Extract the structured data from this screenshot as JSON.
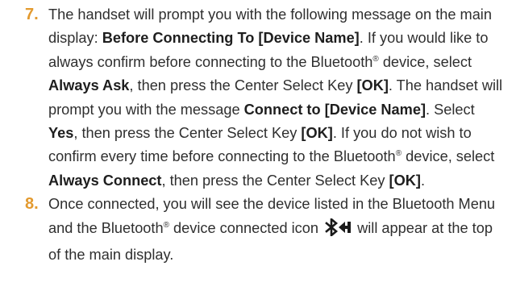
{
  "steps": [
    {
      "number": "7.",
      "t1": "The handset will prompt you with the following message on the main display: ",
      "b1": "Before Connecting To [Device Name]",
      "t2": ". If you would like to always confirm before connecting to the Bluetooth",
      "reg1": "®",
      "t3": " device, select ",
      "b2": "Always Ask",
      "t4": ", then press the Center Select Key ",
      "b3": "[OK]",
      "t5": ". The handset will prompt you with the message ",
      "b4": "Connect to [Device Name]",
      "t6": ". Select ",
      "b5": "Yes",
      "t7": ", then press the Center Select Key ",
      "b6": "[OK]",
      "t8": ". If you do not wish to confirm every time before connecting to the Bluetooth",
      "reg2": "®",
      "t9": " device, select ",
      "b7": "Always Connect",
      "t10": ", then press the Center Select Key ",
      "b8": "[OK]",
      "t11": "."
    },
    {
      "number": "8.",
      "t1": "Once connected, you will see the device listed in the Bluetooth Menu and the Bluetooth",
      "reg1": "®",
      "t2": " device connected icon ",
      "icon": "bluetooth-connected-icon",
      "t3": " will appear at the top of the main display."
    }
  ],
  "colors": {
    "step_number": "#e39a2f",
    "body_text": "#2f2f2f",
    "icon": "#1a1a1a"
  }
}
